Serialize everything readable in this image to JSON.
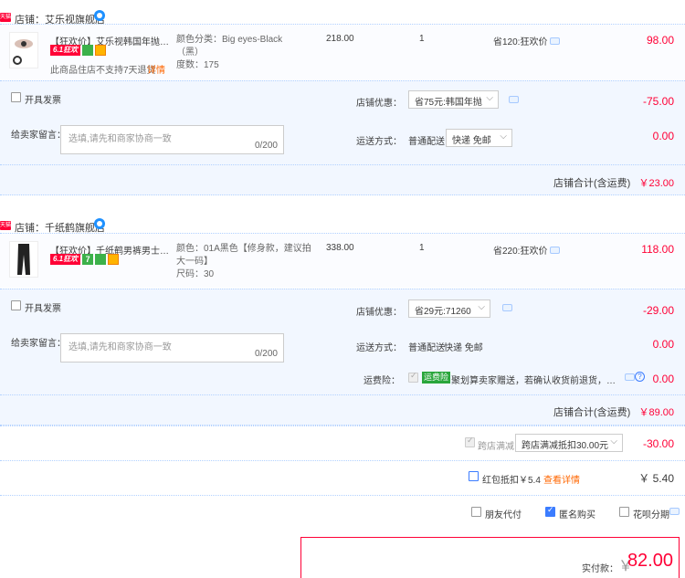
{
  "stores": [
    {
      "badge": "天猫",
      "name": "店铺：艾乐视旗舰店",
      "item": {
        "title": "【狂欢价】艾乐视韩国年抛美瞳...",
        "tag61": "6.1狂欢",
        "notice": "此商品住店不支持7天退货",
        "notice_link": "详情",
        "sku_line1": "颜色分类：Big eyes-Black",
        "sku_line2": "（黑）",
        "sku_line3": "度数：175",
        "price": "218.00",
        "qty": "1",
        "promo": "省120:狂欢价",
        "amount": "98.00"
      },
      "invoice_label": "开具发票",
      "discount_label": "店铺优惠：",
      "discount_value": "省75元:韩国年抛",
      "discount_amount": "-75.00",
      "memo_label": "给卖家留言：",
      "memo_placeholder": "选填,请先和商家协商一致",
      "memo_count": "0/200",
      "ship_label": "运送方式：",
      "ship_type": "普通配送",
      "ship_value": "快递 免邮",
      "ship_amount": "0.00",
      "total_label": "店铺合计(含运费)",
      "total_amount": "￥23.00"
    },
    {
      "badge": "天猫",
      "name": "店铺：千纸鹤旗舰店",
      "item": {
        "title": "【狂欢价】千纸鹤男裤男士修身...",
        "tag61": "6.1狂欢",
        "tag7": "7",
        "sku_line1": "颜色：01A黑色【修身款，建议拍",
        "sku_line2": "大一码】",
        "sku_line3": "尺码：30",
        "price": "338.00",
        "qty": "1",
        "promo": "省220:狂欢价",
        "amount": "118.00"
      },
      "invoice_label": "开具发票",
      "discount_label": "店铺优惠：",
      "discount_value": "省29元:71260",
      "discount_amount": "-29.00",
      "memo_label": "给卖家留言：",
      "memo_placeholder": "选填,请先和商家协商一致",
      "memo_count": "0/200",
      "ship_label": "运送方式：",
      "ship_type": "普通配送",
      "ship_value": "快递 免邮",
      "ship_amount": "0.00",
      "insurance_label": "运费险：",
      "insurance_badge": "运费险",
      "insurance_text": "聚划算卖家赠送，若确认收货前退货，可获...",
      "insurance_amount": "0.00",
      "total_label": "店铺合计(含运费)",
      "total_amount": "￥89.00"
    }
  ],
  "cross_store": {
    "label": "跨店满减",
    "select_value": "跨店满减抵扣30.00元",
    "amount": "-30.00"
  },
  "red_packet": {
    "label": "红包抵扣￥5.4",
    "link": "查看详情",
    "amount": "￥ 5.40"
  },
  "options": {
    "friend_pay": "朋友代付",
    "anonymous": "匿名购买",
    "huabei": "花呗分期"
  },
  "final": {
    "label": "实付款：",
    "currency": "￥",
    "amount": "82.00"
  },
  "colors": {
    "accent_red": "#ff0036",
    "link_orange": "#ff6600",
    "row_blue": "#f2f7ff"
  }
}
